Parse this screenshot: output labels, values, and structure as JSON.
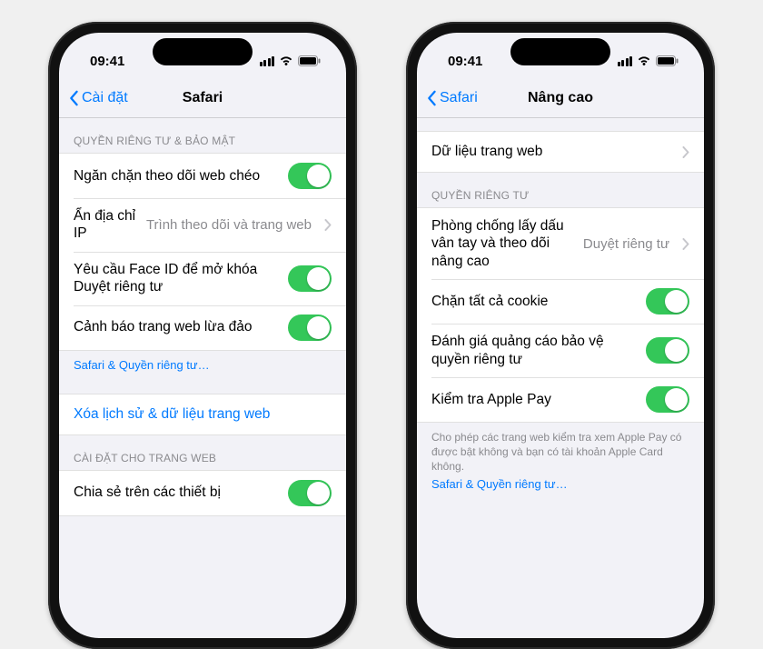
{
  "status": {
    "time": "09:41"
  },
  "left": {
    "back": "Cài đặt",
    "title": "Safari",
    "section1_header": "Quyền riêng tư & bảo mật",
    "row_prevent_tracking": "Ngăn chặn theo dõi web chéo",
    "row_hide_ip_label": "Ẩn địa chỉ IP",
    "row_hide_ip_value": "Trình theo dõi và trang web",
    "row_faceid": "Yêu cầu Face ID để mở khóa Duyệt riêng tư",
    "row_fraud_warning": "Cảnh báo trang web lừa đảo",
    "privacy_link": "Safari & Quyền riêng tư…",
    "row_clear_history": "Xóa lịch sử & dữ liệu trang web",
    "section2_header": "Cài đặt cho trang web",
    "row_share_devices": "Chia sẻ trên các thiết bị"
  },
  "right": {
    "back": "Safari",
    "title": "Nâng cao",
    "row_website_data": "Dữ liệu trang web",
    "section_privacy_header": "Quyền riêng tư",
    "row_fingerprint_label": "Phòng chống lấy dấu vân tay và theo dõi nâng cao",
    "row_fingerprint_value": "Duyệt riêng tư",
    "row_block_cookies": "Chặn tất cả cookie",
    "row_ad_measurement": "Đánh giá quảng cáo bảo vệ quyền riêng tư",
    "row_apple_pay": "Kiểm tra Apple Pay",
    "footer_text": "Cho phép các trang web kiểm tra xem Apple Pay có được bật không và bạn có tài khoản Apple Card không.",
    "privacy_link": "Safari & Quyền riêng tư…"
  }
}
